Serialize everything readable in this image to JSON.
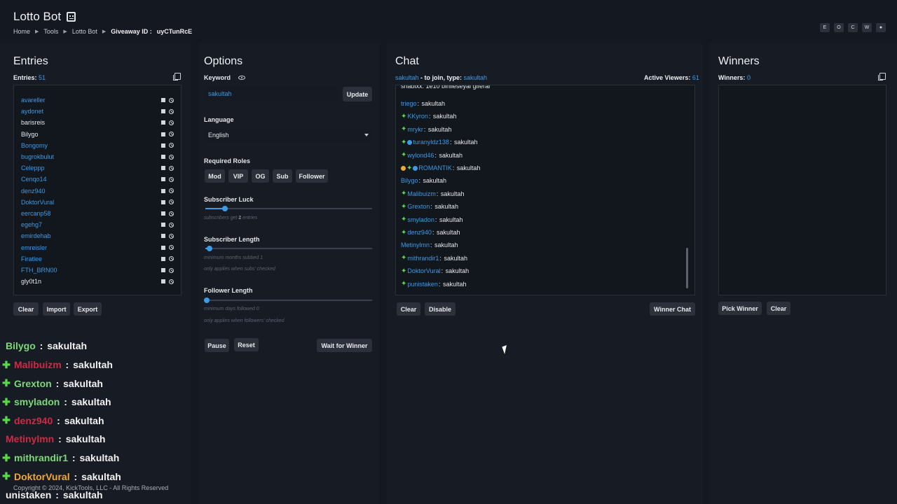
{
  "app": {
    "title": "Lotto Bot"
  },
  "breadcrumb": {
    "home": "Home",
    "tools": "Tools",
    "current": "Lotto Bot",
    "giveaway_label": "Giveaway ID :",
    "giveaway_id": "uyCTunRcE"
  },
  "corner_buttons": [
    "E",
    "O",
    "C",
    "W",
    "●"
  ],
  "entries": {
    "title": "Entries",
    "count_label": "Entries:",
    "count": "51",
    "items": [
      {
        "name": "avareller",
        "color": "#3b9be8"
      },
      {
        "name": "aydonet",
        "color": "#3b9be8"
      },
      {
        "name": "barisreis",
        "color": "#e6e8ec"
      },
      {
        "name": "Bilygo",
        "color": "#e6e8ec"
      },
      {
        "name": "Bongomy",
        "color": "#3b9be8"
      },
      {
        "name": "bugrokbulut",
        "color": "#3b9be8"
      },
      {
        "name": "Celeppp",
        "color": "#3b9be8"
      },
      {
        "name": "Cenqo14",
        "color": "#3b9be8"
      },
      {
        "name": "denz940",
        "color": "#3b9be8"
      },
      {
        "name": "DoktorVural",
        "color": "#3b9be8"
      },
      {
        "name": "eercanp58",
        "color": "#3b9be8"
      },
      {
        "name": "egehg7",
        "color": "#3b9be8"
      },
      {
        "name": "emirdehab",
        "color": "#3b9be8"
      },
      {
        "name": "emreisler",
        "color": "#3b9be8"
      },
      {
        "name": "Firatlee",
        "color": "#3b9be8"
      },
      {
        "name": "FTH_BRN00",
        "color": "#3b9be8"
      },
      {
        "name": "gly0t1n",
        "color": "#e6e8ec"
      }
    ],
    "buttons": {
      "clear": "Clear",
      "import": "Import",
      "export": "Export"
    }
  },
  "options": {
    "title": "Options",
    "keyword_label": "Keyword",
    "keyword_value": "sakultah",
    "update": "Update",
    "language_label": "Language",
    "language_value": "English",
    "roles_label": "Required Roles",
    "roles": [
      "Mod",
      "VIP",
      "OG",
      "Sub",
      "Follower"
    ],
    "sub_luck_label": "Subscriber Luck",
    "sub_luck_hint_pre": "subscribers get ",
    "sub_luck_value": "2",
    "sub_luck_hint_post": " entries",
    "sub_length_label": "Subscriber Length",
    "sub_length_hint": "minimum months subbed 1",
    "sub_length_hint2": "only applies when subs' checked",
    "fol_length_label": "Follower Length",
    "fol_length_hint": "minimum days followed 0",
    "fol_length_hint2": "only applies when followers' checked",
    "pause": "Pause",
    "reset": "Reset",
    "wait": "Wait for Winner"
  },
  "chat": {
    "title": "Chat",
    "join_user": "sakultah",
    "join_mid": " - to join, type: ",
    "join_keyword": "sakultah",
    "viewers_label": "Active Viewers:",
    "viewers": "61",
    "partial_top": "shabixx: 1e10 birilleseyal giferal",
    "messages": [
      {
        "user": "triego",
        "text": "sakultah",
        "badges": "",
        "color": "#3b9be8"
      },
      {
        "user": "KKyron",
        "text": "sakultah",
        "badges": "star",
        "color": "#3b9be8"
      },
      {
        "user": "mrykr",
        "text": "sakultah",
        "badges": "star",
        "color": "#3b9be8"
      },
      {
        "user": "turanyldz138",
        "text": "sakultah",
        "badges": "star-globe",
        "color": "#3b9be8"
      },
      {
        "user": "wylond46",
        "text": "sakultah",
        "badges": "star",
        "color": "#3b9be8"
      },
      {
        "user": "ROMANTIK",
        "text": "sakultah",
        "badges": "coin-star-globe",
        "color": "#3b9be8"
      },
      {
        "user": "Bilygo",
        "text": "sakultah",
        "badges": "",
        "color": "#3b9be8"
      },
      {
        "user": "Malibuizm",
        "text": "sakultah",
        "badges": "star",
        "color": "#3b9be8"
      },
      {
        "user": "Grexton",
        "text": "sakultah",
        "badges": "star",
        "color": "#3b9be8"
      },
      {
        "user": "smyladon",
        "text": "sakultah",
        "badges": "star",
        "color": "#3b9be8"
      },
      {
        "user": "denz940",
        "text": "sakultah",
        "badges": "star",
        "color": "#3b9be8"
      },
      {
        "user": "Metinylmn",
        "text": "sakultah",
        "badges": "",
        "color": "#3b9be8"
      },
      {
        "user": "mithrandir1",
        "text": "sakultah",
        "badges": "star",
        "color": "#3b9be8"
      },
      {
        "user": "DoktorVural",
        "text": "sakultah",
        "badges": "star",
        "color": "#3b9be8"
      },
      {
        "user": "punistaken",
        "text": "sakultah",
        "badges": "star",
        "color": "#3b9be8"
      }
    ],
    "clear": "Clear",
    "disable": "Disable",
    "winner_chat": "Winner Chat"
  },
  "winners": {
    "title": "Winners",
    "count_label": "Winners:",
    "count": "0",
    "pick": "Pick Winner",
    "clear": "Clear"
  },
  "overlay": [
    {
      "user": "Bilygo",
      "text": "sakultah",
      "star": false,
      "color": "#7dd87a"
    },
    {
      "user": "Malibuizm",
      "text": "sakultah",
      "star": true,
      "color": "#d22845"
    },
    {
      "user": "Grexton",
      "text": "sakultah",
      "star": true,
      "color": "#7dd87a"
    },
    {
      "user": "smyladon",
      "text": "sakultah",
      "star": true,
      "color": "#7dd87a"
    },
    {
      "user": "denz940",
      "text": "sakultah",
      "star": true,
      "color": "#d22845"
    },
    {
      "user": "Metinylmn",
      "text": "sakultah",
      "star": false,
      "color": "#d22845"
    },
    {
      "user": "mithrandir1",
      "text": "sakultah",
      "star": true,
      "color": "#7dd87a"
    },
    {
      "user": "DoktorVural",
      "text": "sakultah",
      "star": true,
      "color": "#f0a838"
    },
    {
      "user": "unistaken",
      "text": "sakultah",
      "star": false,
      "color": "#f2f2f2"
    }
  ],
  "footer": "Copyright © 2024, KickTools, LLC - All Rights Reserved"
}
